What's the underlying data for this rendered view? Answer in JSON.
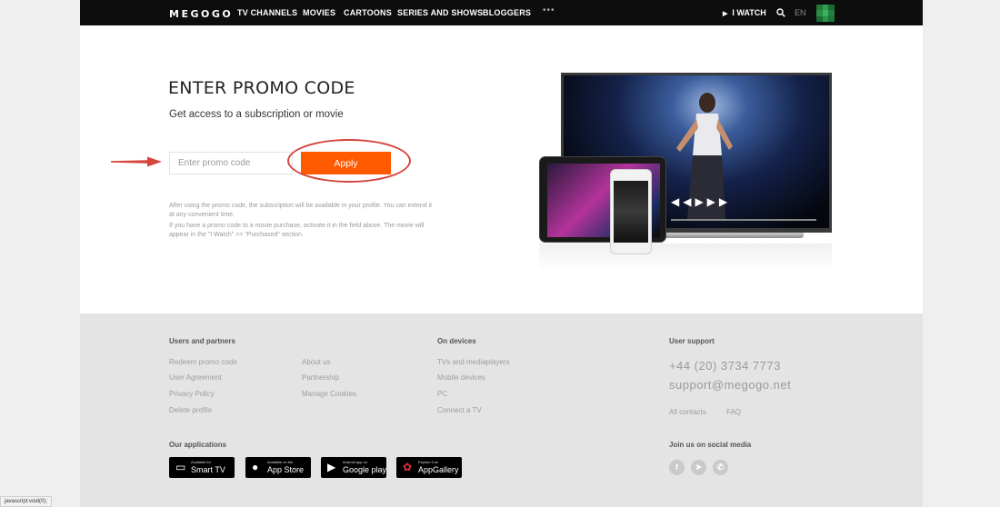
{
  "header": {
    "logo": "MEGOGO",
    "nav": [
      "TV CHANNELS",
      "MOVIES",
      "CARTOONS",
      "SERIES AND SHOWS",
      "BLOGGERS"
    ],
    "more": "•••",
    "i_watch": "I WATCH",
    "language": "EN"
  },
  "main": {
    "title": "ENTER PROMO CODE",
    "subtitle": "Get access to a subscription or movie",
    "input_placeholder": "Enter promo code",
    "apply_label": "Apply",
    "note1": "After using the promo code, the subscription will be available in your profile. You can extend it at any convenient time.",
    "note2": "If you have a promo code to a movie purchase, activate it in the field above. The movie will appear in the \"I Watch\" >> \"Purchased\" section."
  },
  "footer": {
    "users_heading": "Users and partners",
    "users_links": [
      "Redeem promo code",
      "User Agreement",
      "Privacy Policy",
      "Delete profile"
    ],
    "partner_links": [
      "About us",
      "Partnership",
      "Manage Cookies"
    ],
    "devices_heading": "On devices",
    "devices_links": [
      "TVs and mediaplayers",
      "Mobile devices",
      "PC",
      "Connect a TV"
    ],
    "support_heading": "User support",
    "support_phone": "+44 (20) 3734 7773",
    "support_email": "support@megogo.net",
    "support_links": [
      "All contacts",
      "FAQ"
    ],
    "apps_heading": "Our applications",
    "apps": [
      {
        "small": "Available for",
        "big": "Smart TV",
        "icon": "tv-icon"
      },
      {
        "small": "Available on the",
        "big": "App Store",
        "icon": "apple-icon"
      },
      {
        "small": "Android app on",
        "big": "Google play",
        "icon": "google-play-icon"
      },
      {
        "small": "Explore it on",
        "big": "AppGallery",
        "icon": "huawei-icon"
      }
    ],
    "social_heading": "Join us on social media",
    "social": [
      "facebook-icon",
      "telegram-icon",
      "viber-icon"
    ]
  },
  "status_bar": "javascript:void(0);",
  "colors": {
    "accent": "#ff5a00",
    "highlight": "#d5443b",
    "header_bg": "#0d0d0d",
    "footer_bg": "#e4e4e4"
  }
}
